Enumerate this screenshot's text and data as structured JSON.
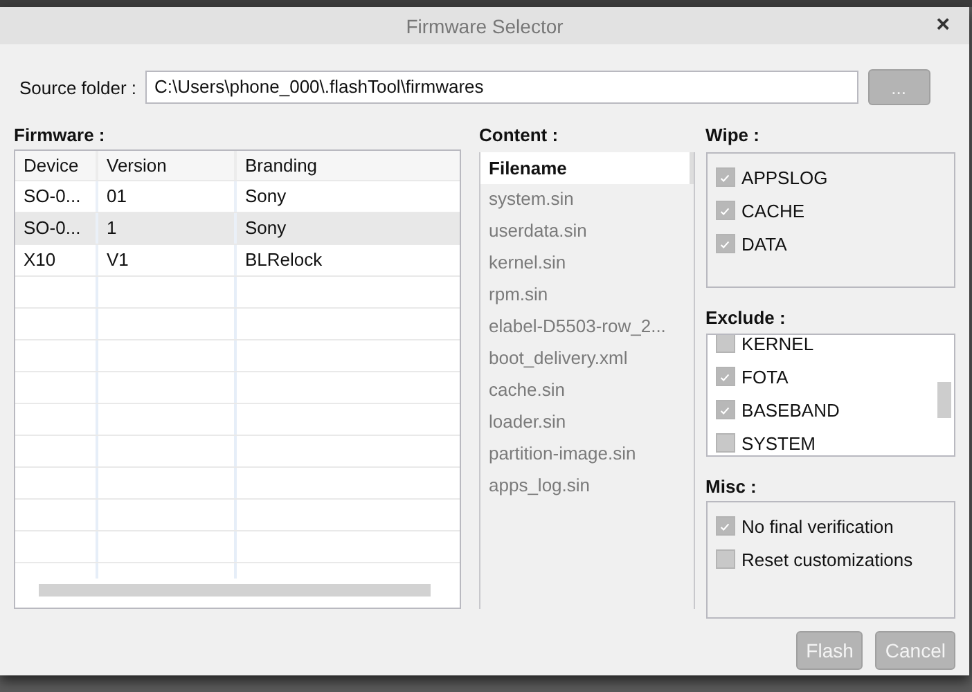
{
  "window": {
    "title": "Firmware Selector",
    "close": "×"
  },
  "source": {
    "label": "Source folder :",
    "value": "C:\\Users\\phone_000\\.flashTool\\firmwares",
    "browse": {
      "label": "...",
      "disabled": true
    }
  },
  "firmware": {
    "label": "Firmware :",
    "columns": [
      "Device",
      "Version",
      "Branding"
    ],
    "rows": [
      {
        "cells": [
          "SO-0...",
          "01",
          "Sony"
        ],
        "selected": false
      },
      {
        "cells": [
          "SO-0...",
          "1",
          "Sony"
        ],
        "selected": true
      },
      {
        "cells": [
          "X10",
          "V1",
          "BLRelock"
        ],
        "selected": false
      }
    ]
  },
  "content": {
    "label": "Content :",
    "column": "Filename",
    "items": [
      "system.sin",
      "userdata.sin",
      "kernel.sin",
      "rpm.sin",
      "elabel-D5503-row_2...",
      "boot_delivery.xml",
      "cache.sin",
      "loader.sin",
      "partition-image.sin",
      "apps_log.sin"
    ]
  },
  "wipe": {
    "label": "Wipe :",
    "items": [
      {
        "label": "APPSLOG",
        "checked": true
      },
      {
        "label": "CACHE",
        "checked": true
      },
      {
        "label": "DATA",
        "checked": true
      }
    ]
  },
  "exclude": {
    "label": "Exclude :",
    "items": [
      {
        "label": "KERNEL",
        "checked": false
      },
      {
        "label": "FOTA",
        "checked": true
      },
      {
        "label": "BASEBAND",
        "checked": true
      },
      {
        "label": "SYSTEM",
        "checked": false
      }
    ]
  },
  "misc": {
    "label": "Misc :",
    "items": [
      {
        "label": "No final verification",
        "checked": true
      },
      {
        "label": "Reset customizations",
        "checked": false
      }
    ]
  },
  "buttons": [
    {
      "label": "Flash",
      "disabled": true
    },
    {
      "label": "Cancel",
      "disabled": true
    }
  ]
}
